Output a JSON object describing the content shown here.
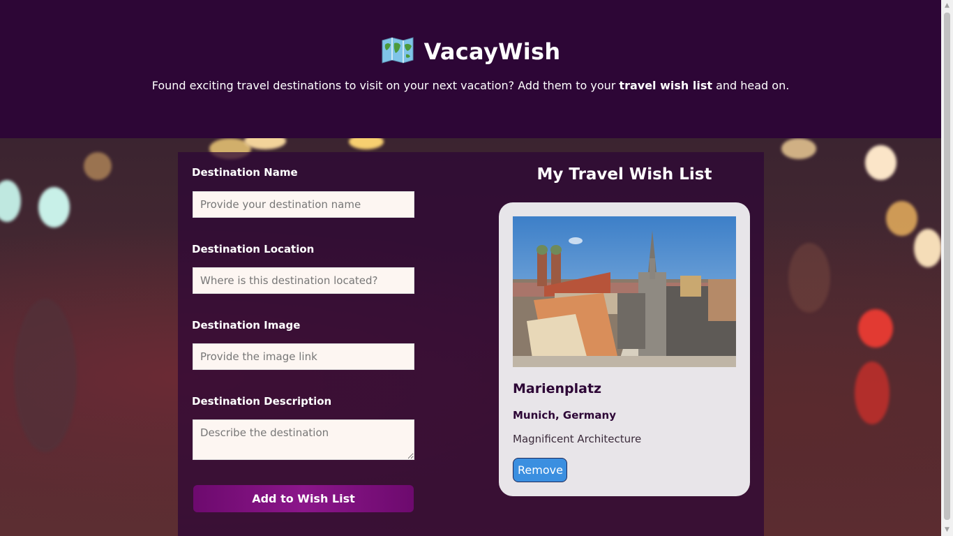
{
  "header": {
    "brand_title": "VacayWish",
    "tagline_pre": "Found exciting travel destinations to visit on your next vacation? Add them to your ",
    "tagline_bold": "travel wish list",
    "tagline_post": " and head on.",
    "logo_icon": "world-map-icon"
  },
  "form": {
    "name_label": "Destination Name",
    "name_placeholder": "Provide your destination name",
    "location_label": "Destination Location",
    "location_placeholder": "Where is this destination located?",
    "image_label": "Destination Image",
    "image_placeholder": "Provide the image link",
    "description_label": "Destination Description",
    "description_placeholder": "Describe the destination",
    "submit_label": "Add to Wish List"
  },
  "wishlist": {
    "title": "My Travel Wish List",
    "items": [
      {
        "name": "Marienplatz",
        "location": "Munich, Germany",
        "description": "Magnificent Architecture",
        "remove_label": "Remove"
      }
    ]
  },
  "colors": {
    "header_bg": "#2d0636",
    "button_purple": "#8b168a",
    "remove_blue": "#3b8fe0"
  }
}
